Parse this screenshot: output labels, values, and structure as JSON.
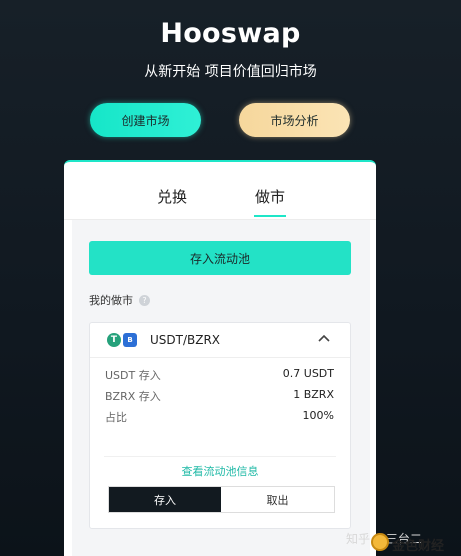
{
  "header": {
    "title": "Hooswap",
    "subtitle": "从新开始 项目价值回归市场"
  },
  "hero_buttons": {
    "create_market": "创建市场",
    "market_analysis": "市场分析"
  },
  "tabs": [
    {
      "label": "兑换",
      "active": false
    },
    {
      "label": "做市",
      "active": true
    }
  ],
  "deposit_button": "存入流动池",
  "my_market": {
    "label": "我的做市",
    "help": "?"
  },
  "pool": {
    "token_a_icon": "T",
    "token_b_icon": "B",
    "pair": "USDT/BZRX",
    "rows": [
      {
        "label": "USDT 存入",
        "value": "0.7 USDT"
      },
      {
        "label": "BZRX 存入",
        "value": "1 BZRX"
      },
      {
        "label": "占比",
        "value": "100%"
      }
    ],
    "view_info": "查看流动池信息",
    "deposit_label": "存入",
    "withdraw_label": "取出"
  },
  "watermark": {
    "zhihu": "知乎 @三台二",
    "brand": "金色财经"
  },
  "colors": {
    "accent": "#23e2c6",
    "gold": "#f6d79c",
    "dark": "#121a20"
  }
}
